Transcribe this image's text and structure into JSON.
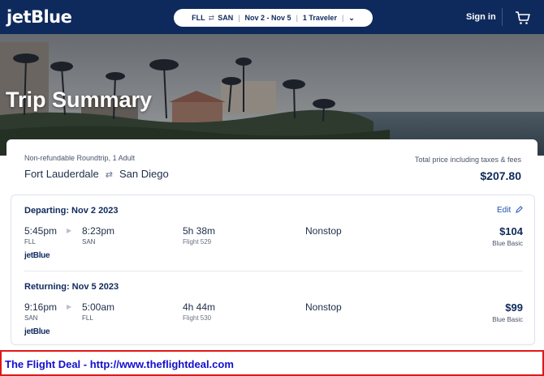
{
  "header": {
    "logo": "jetBlue",
    "search": {
      "origin": "FLL",
      "swap_glyph": "⇄",
      "destination": "SAN",
      "dates": "Nov 2 - Nov 5",
      "travelers": "1 Traveler",
      "chevron": "⌄"
    },
    "sign_in": "Sign in",
    "cart_icon": "cart-icon"
  },
  "hero": {
    "title": "Trip Summary"
  },
  "summary": {
    "trip_type": "Non-refundable Roundtrip, 1 Adult",
    "origin_city": "Fort Lauderdale",
    "swap_glyph": "⇄",
    "destination_city": "San Diego",
    "total_label": "Total price including taxes & fees",
    "total_price": "$207.80"
  },
  "legs": [
    {
      "title": "Departing: Nov 2 2023",
      "edit_label": "Edit",
      "depart_time": "5:45pm",
      "depart_code": "FLL",
      "arrive_time": "8:23pm",
      "arrive_code": "SAN",
      "duration": "5h 38m",
      "flight": "Flight 529",
      "stops": "Nonstop",
      "price": "$104",
      "fare": "Blue Basic",
      "carrier": "jetBlue"
    },
    {
      "title": "Returning: Nov 5 2023",
      "depart_time": "9:16pm",
      "depart_code": "SAN",
      "arrive_time": "5:00am",
      "arrive_code": "FLL",
      "duration": "4h 44m",
      "flight": "Flight 530",
      "stops": "Nonstop",
      "price": "$99",
      "fare": "Blue Basic",
      "carrier": "jetBlue"
    }
  ],
  "banner": {
    "text": "The Flight Deal - http://www.theflightdeal.com"
  },
  "colors": {
    "header_bg": "#0e2a5c",
    "accent_link": "#1f4fae",
    "banner_border": "#e01818",
    "banner_text": "#1010d0"
  }
}
